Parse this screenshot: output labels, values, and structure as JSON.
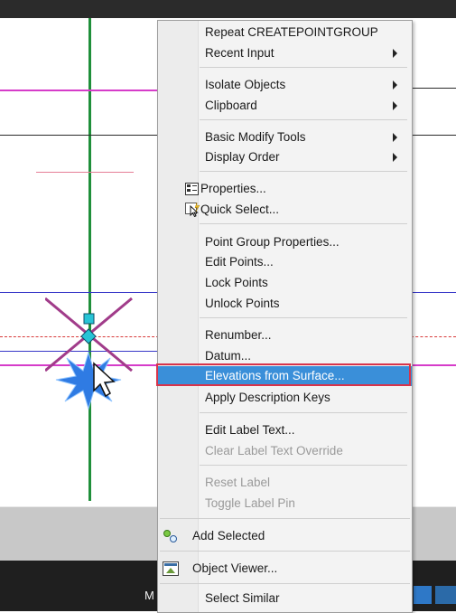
{
  "menu": {
    "items": [
      {
        "label": "Repeat CREATEPOINTGROUP",
        "submenu": false
      },
      {
        "label": "Recent Input",
        "submenu": true
      },
      {
        "label": "Isolate Objects",
        "submenu": true
      },
      {
        "label": "Clipboard",
        "submenu": true
      },
      {
        "label": "Basic Modify Tools",
        "submenu": true
      },
      {
        "label": "Display Order",
        "submenu": true
      },
      {
        "label": "Properties...",
        "icon": "properties-icon"
      },
      {
        "label": "Quick Select...",
        "icon": "quick-select-icon"
      },
      {
        "label": "Point Group Properties..."
      },
      {
        "label": "Edit Points..."
      },
      {
        "label": "Lock Points"
      },
      {
        "label": "Unlock Points"
      },
      {
        "label": "Renumber..."
      },
      {
        "label": "Datum..."
      },
      {
        "label": "Elevations from Surface...",
        "highlighted": true
      },
      {
        "label": "Apply Description Keys"
      },
      {
        "label": "Edit Label Text..."
      },
      {
        "label": "Clear Label Text Override",
        "disabled": true
      },
      {
        "label": "Reset Label",
        "disabled": true
      },
      {
        "label": "Toggle Label Pin",
        "disabled": true
      },
      {
        "label": "Add Selected",
        "icon": "add-selected-icon"
      },
      {
        "label": "Object Viewer...",
        "icon": "object-viewer-icon"
      },
      {
        "label": "Select Similar"
      }
    ]
  },
  "statusbar": {
    "left_text": "M"
  },
  "colors": {
    "highlight": "#3a8fd9",
    "highlight_border": "#d8334a",
    "green_line": "#1f8f3a",
    "magenta_line": "#d63cc9",
    "blue_line": "#3838c8"
  }
}
